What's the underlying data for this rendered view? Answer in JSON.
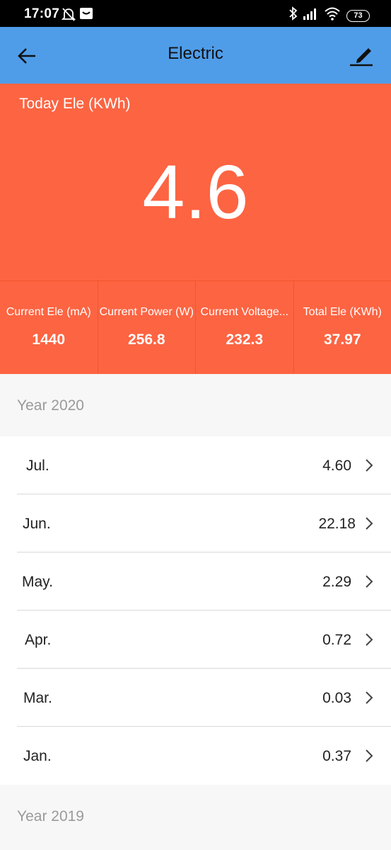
{
  "status_bar": {
    "time": "17:07",
    "battery": "73",
    "icons": [
      "alarm-off-icon",
      "message-icon",
      "bluetooth-icon",
      "signal-icon",
      "wifi-icon",
      "battery-icon"
    ]
  },
  "header": {
    "title": "Electric",
    "back_icon": "arrow-left-icon",
    "edit_icon": "edit-pen-icon",
    "background": "#4f9de9"
  },
  "today": {
    "label": "Today Ele (KWh)",
    "value": "4.6",
    "background": "#fd6442"
  },
  "stats": [
    {
      "label": "Current Ele (mA)",
      "value": "1440"
    },
    {
      "label": "Current Power (W)",
      "value": "256.8"
    },
    {
      "label": "Current Voltage...",
      "value": "232.3"
    },
    {
      "label": "Total Ele (KWh)",
      "value": "37.97"
    }
  ],
  "years": [
    {
      "year": "Year 2020",
      "months": [
        {
          "month": "Jul.",
          "value": "4.60"
        },
        {
          "month": "Jun.",
          "value": "22.18"
        },
        {
          "month": "May.",
          "value": "2.29"
        },
        {
          "month": "Apr.",
          "value": "0.72"
        },
        {
          "month": "Mar.",
          "value": "0.03"
        },
        {
          "month": "Jan.",
          "value": "0.37"
        }
      ]
    },
    {
      "year": "Year 2019",
      "months": []
    }
  ]
}
